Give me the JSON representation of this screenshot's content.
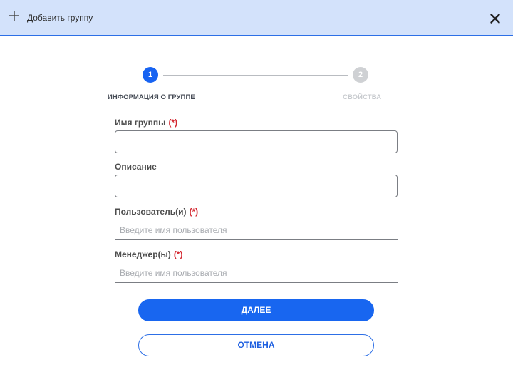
{
  "header": {
    "title": "Добавить группу",
    "add_icon": "plus-icon",
    "close_icon": "close-icon"
  },
  "stepper": {
    "steps": [
      {
        "number": "1",
        "label": "ИНФОРМАЦИЯ О ГРУППЕ",
        "state": "active"
      },
      {
        "number": "2",
        "label": "СВОЙСТВА",
        "state": "inactive"
      }
    ]
  },
  "form": {
    "group_name": {
      "label": "Имя группы",
      "required_mark": "(*)",
      "value": ""
    },
    "description": {
      "label": "Описание",
      "value": ""
    },
    "users": {
      "label": "Пользователь(и)",
      "required_mark": "(*)",
      "placeholder": "Введите имя пользователя",
      "value": ""
    },
    "managers": {
      "label": "Менеджер(ы)",
      "required_mark": "(*)",
      "placeholder": "Введите имя пользователя",
      "value": ""
    }
  },
  "buttons": {
    "next_label": "ДАЛЕЕ",
    "cancel_label": "ОТМЕНА"
  },
  "colors": {
    "header_bg": "#d3e2fb",
    "accent": "#1866f0",
    "required": "#d3262f",
    "inactive_step": "#cfd1d4"
  }
}
